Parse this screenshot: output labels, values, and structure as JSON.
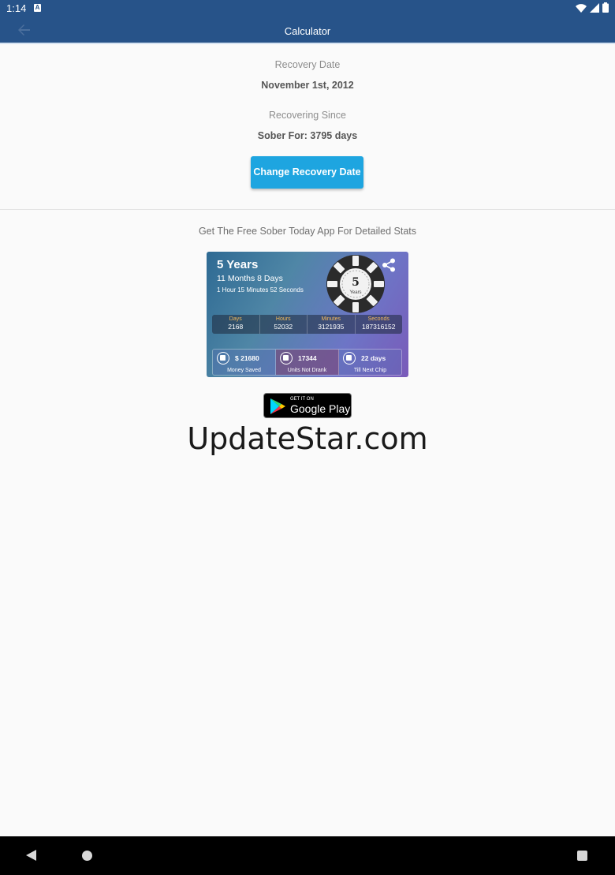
{
  "status_bar": {
    "time": "1:14",
    "notif_letter": "A"
  },
  "app_bar": {
    "title": "Calculator"
  },
  "recovery": {
    "date_label": "Recovery Date",
    "date_value": "November 1st, 2012",
    "since_label": "Recovering Since",
    "since_value": "Sober For: 3795 days",
    "change_button": "Change Recovery Date"
  },
  "promo": {
    "headline": "Get The Free Sober Today App For Detailed Stats",
    "card": {
      "years": "5 Years",
      "months_days": "11 Months 8 Days",
      "time": "1 Hour 15 Minutes 52 Seconds",
      "chip_number": "5",
      "chip_label": "Years",
      "stats": [
        {
          "label": "Days",
          "value": "2168"
        },
        {
          "label": "Hours",
          "value": "52032"
        },
        {
          "label": "Minutes",
          "value": "3121935"
        },
        {
          "label": "Seconds",
          "value": "187316152"
        }
      ],
      "bottom": [
        {
          "value": "$ 21680",
          "label": "Money Saved",
          "icon": "wallet-icon"
        },
        {
          "value": "17344",
          "label": "Units Not Drank",
          "icon": "glass-icon"
        },
        {
          "value": "22 days",
          "label": "Till Next Chip",
          "icon": "calendar-icon"
        }
      ]
    },
    "store_badge": {
      "small": "GET IT ON",
      "big": "Google Play"
    }
  },
  "watermark": "UpdateStar.com",
  "colors": {
    "primary": "#275389",
    "accent_button": "#1ea5e0",
    "stat_key": "#f3b95b"
  }
}
